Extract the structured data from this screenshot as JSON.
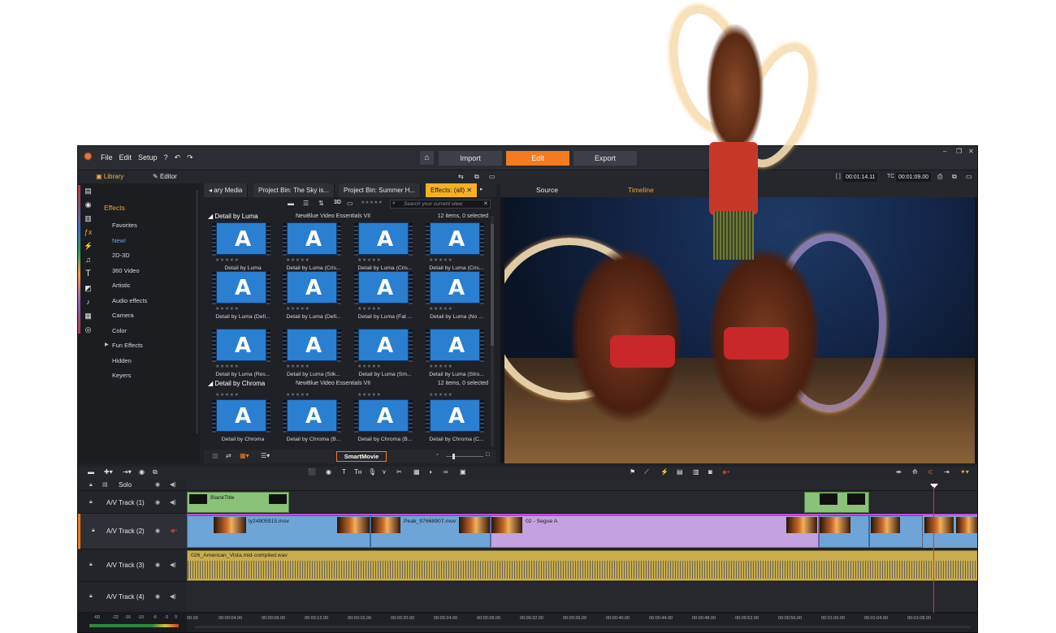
{
  "topbar": {
    "menu": [
      "File",
      "Edit",
      "Setup",
      "?",
      "↶",
      "↷"
    ],
    "mode_tabs": [
      {
        "label": "Import",
        "active": false
      },
      {
        "label": "Edit",
        "active": true
      },
      {
        "label": "Export",
        "active": false
      }
    ],
    "accent": "#f47b20"
  },
  "subbar": {
    "library_tab": "Library",
    "editor_tab": "Editor",
    "timecode_a_label": "[ ]",
    "timecode_a": "00:01:14.11",
    "timecode_b_label": "TC",
    "timecode_b": "00:01:09.00"
  },
  "categories": {
    "header": "Effects",
    "items": [
      "Favorites",
      "New!",
      "2D-3D",
      "360 Video",
      "Artistic",
      "Audio effects",
      "Camera",
      "Color",
      "Fun Effects",
      "Hidden",
      "Keyers"
    ]
  },
  "library": {
    "tabs": [
      {
        "label": "◂ ary Media",
        "active": false
      },
      {
        "label": "Project Bin: The Sky is...",
        "active": false
      },
      {
        "label": "Project Bin: Summer H...",
        "active": false
      },
      {
        "label": "Effects: (all)",
        "active": true
      }
    ],
    "search_placeholder": "Search your current view",
    "view_3d": "3D",
    "groups": [
      {
        "title": "Detail by Luma",
        "pack": "NewBlue Video Essentials VII",
        "count": "12 items, 0 selected",
        "items": [
          "Detail by Luma",
          "Detail by Luma (Cris...",
          "Detail by Luma (Cris...",
          "Detail by Luma (Cris...",
          "Detail by Luma (Defi...",
          "Detail by Luma (Defi...",
          "Detail by Luma (Fat ...",
          "Detail by Luma (No ...",
          "Detail by Luma (Res...",
          "Detail by Luma (Silk...",
          "Detail by Luma (Sm...",
          "Detail by Luma (Stro..."
        ]
      },
      {
        "title": "Detail by Chroma",
        "pack": "NewBlue Video Essentials VII",
        "count": "12 items, 0 selected",
        "items": [
          "Detail by Chroma",
          "Detail by Chroma (B...",
          "Detail by Chroma (B...",
          "Detail by Chroma (C..."
        ]
      }
    ],
    "thumb_glyph": "A",
    "stars": "★★★★★",
    "smartmovie_label": "SmartMovie"
  },
  "preview": {
    "tabs": [
      {
        "label": "Source",
        "active": false
      },
      {
        "label": "Timeline",
        "active": true
      }
    ]
  },
  "timeline": {
    "tracks": [
      {
        "name": "Solo"
      },
      {
        "name": "A/V Track (1)"
      },
      {
        "name": "A/V Track (2)"
      },
      {
        "name": "A/V Track (3)"
      },
      {
        "name": "A/V Track (4)"
      }
    ],
    "clips": {
      "title_clip": "BlankTitle",
      "video_clip_1": "ly24905915.mov",
      "video_clip_2": "Peak_97668907.mov",
      "video_clip_3": "02 - Segue A",
      "audio_clip": "026_American_Vista.mid-compiled.wav"
    },
    "ruler": [
      "00.00",
      "00:00:04.00",
      "00:00:08.00",
      "00:00:12.00",
      "00:00:16.00",
      "00:00:20.00",
      "00:00:24.00",
      "00:00:28.00",
      "00:00:32.00",
      "00:00:36.00",
      "00:00:40.00",
      "00:00:44.00",
      "00:00:48.00",
      "00:00:52.00",
      "00:00:56.00",
      "00:01:00.00",
      "00:01:04.00",
      "00:01:08.00"
    ],
    "vu_labels": [
      "-60",
      "-22",
      "-16",
      "-10",
      "-6",
      "-3",
      "0"
    ]
  }
}
